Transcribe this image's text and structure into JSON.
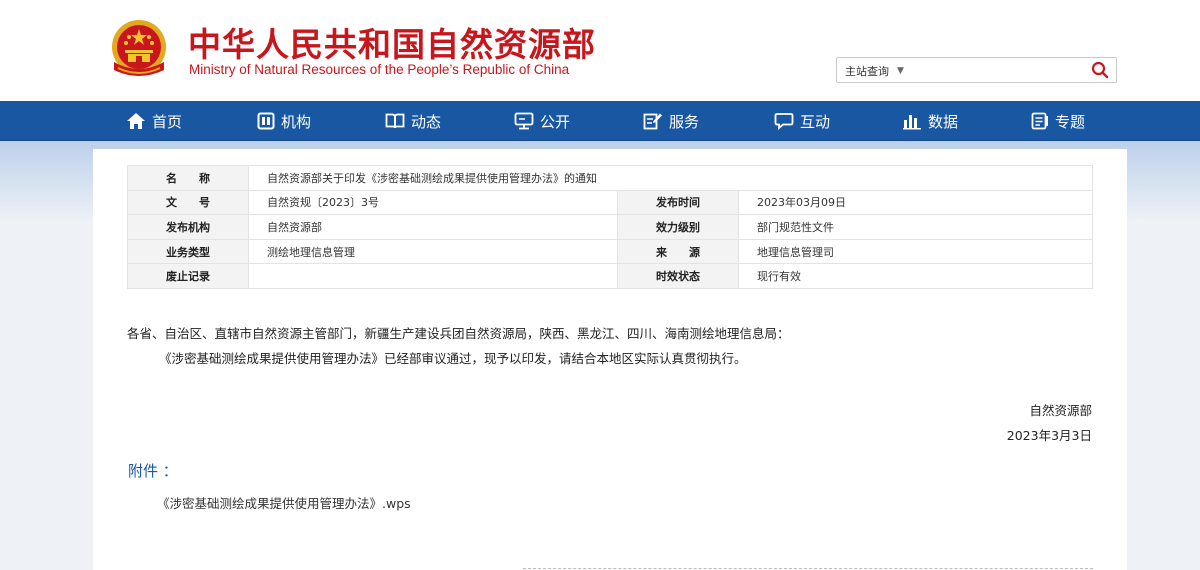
{
  "header": {
    "title": "中华人民共和国自然资源部",
    "subtitle": "Ministry of Natural Resources of the People’s Republic of China",
    "search": {
      "scope": "主站查询",
      "placeholder": ""
    },
    "colors": {
      "brand_red": "#c8161d",
      "nav_blue": "#1a57a3"
    }
  },
  "nav": {
    "items": [
      {
        "label": "首页",
        "icon": "home-icon"
      },
      {
        "label": "机构",
        "icon": "org-icon"
      },
      {
        "label": "动态",
        "icon": "book-icon"
      },
      {
        "label": "公开",
        "icon": "monitor-icon"
      },
      {
        "label": "服务",
        "icon": "edit-icon"
      },
      {
        "label": "互动",
        "icon": "chat-icon"
      },
      {
        "label": "数据",
        "icon": "bar-chart-icon"
      },
      {
        "label": "专题",
        "icon": "topic-icon"
      }
    ]
  },
  "meta": {
    "name_label": "名　　称",
    "name_value": "自然资源部关于印发《涉密基础测绘成果提供使用管理办法》的通知",
    "docno_label": "文　　号",
    "docno_value": "自然资规〔2023〕3号",
    "pubtime_label": "发布时间",
    "pubtime_value": "2023年03月09日",
    "issuer_label": "发布机构",
    "issuer_value": "自然资源部",
    "level_label": "效力级别",
    "level_value": "部门规范性文件",
    "type_label": "业务类型",
    "type_value": "测绘地理信息管理",
    "source_label": "来　　源",
    "source_value": "地理信息管理司",
    "abolish_label": "废止记录",
    "abolish_value": "",
    "status_label": "时效状态",
    "status_value": "现行有效"
  },
  "letter": {
    "addressee": "各省、自治区、直辖市自然资源主管部门，新疆生产建设兵团自然资源局，陕西、黑龙江、四川、海南测绘地理信息局：",
    "body": "《涉密基础测绘成果提供使用管理办法》已经部审议通过，现予以印发，请结合本地区实际认真贯彻执行。",
    "sign_org": "自然资源部",
    "sign_date": "2023年3月3日"
  },
  "attachment": {
    "title": "附件 ：",
    "file": "《涉密基础测绘成果提供使用管理办法》.wps"
  }
}
